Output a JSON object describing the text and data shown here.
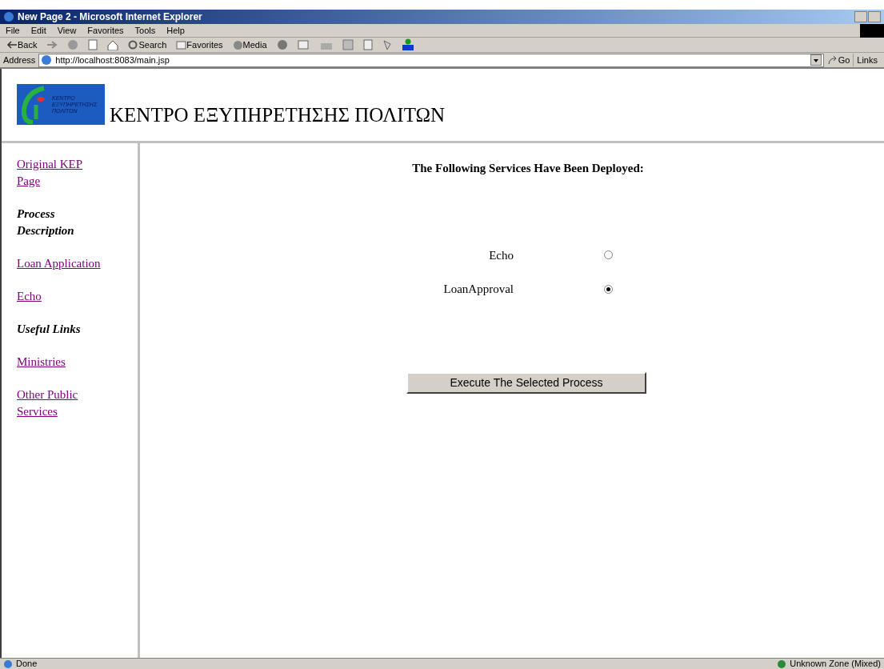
{
  "window": {
    "title": "New Page 2 - Microsoft Internet Explorer"
  },
  "menu": [
    "File",
    "Edit",
    "View",
    "Favorites",
    "Tools",
    "Help"
  ],
  "toolbar": {
    "back": "Back",
    "search": "Search",
    "favorites": "Favorites",
    "media": "Media"
  },
  "address": {
    "label": "Address",
    "value": "http://localhost:8083/main.jsp",
    "go": "Go",
    "links": "Links"
  },
  "header": {
    "logo_lines": [
      "KENTPO",
      "ΕΞΥΠΗΡΕΤΗΣΗΣ",
      "ΠΟΛΙΤΩΝ"
    ],
    "title": "ΚΕΝΤΡΟ ΕΞΥΠΗΡΕΤΗΣΗΣ ΠΟΛΙΤΩΝ"
  },
  "sidebar": {
    "items": [
      {
        "kind": "link",
        "label": "Original KEP Page"
      },
      {
        "kind": "heading",
        "label": "Process Description"
      },
      {
        "kind": "link",
        "label": "Loan Application"
      },
      {
        "kind": "link",
        "label": "Echo"
      },
      {
        "kind": "heading",
        "label": "Useful Links"
      },
      {
        "kind": "link",
        "label": "Ministries"
      },
      {
        "kind": "link",
        "label": "Other Public Services"
      }
    ]
  },
  "main": {
    "heading": "The Following Services Have Been Deployed:",
    "services": [
      {
        "name": "Echo",
        "selected": false
      },
      {
        "name": "LoanApproval",
        "selected": true
      }
    ],
    "button": "Execute The Selected Process"
  },
  "status_bar": {
    "text": "Done",
    "zone": "Unknown Zone (Mixed)"
  }
}
